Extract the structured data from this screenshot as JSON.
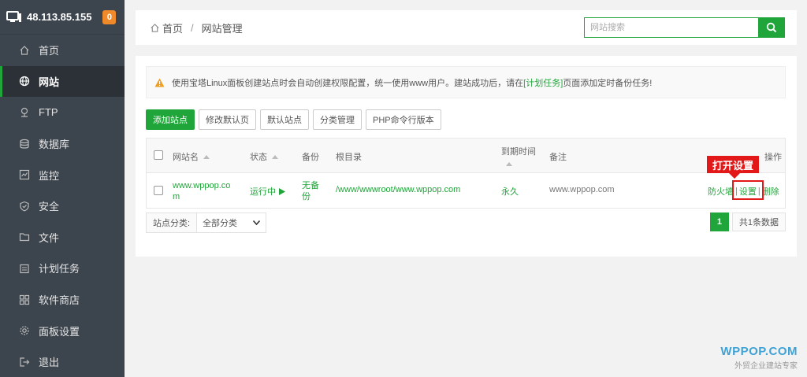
{
  "sidebar": {
    "ip": "48.113.85.155",
    "badge": "0",
    "items": [
      {
        "label": "首页",
        "icon": "home-icon"
      },
      {
        "label": "网站",
        "icon": "globe-icon",
        "active": true
      },
      {
        "label": "FTP",
        "icon": "ftp-icon"
      },
      {
        "label": "数据库",
        "icon": "database-icon"
      },
      {
        "label": "监控",
        "icon": "monitor-icon"
      },
      {
        "label": "安全",
        "icon": "shield-icon"
      },
      {
        "label": "文件",
        "icon": "folder-icon"
      },
      {
        "label": "计划任务",
        "icon": "calendar-icon"
      },
      {
        "label": "软件商店",
        "icon": "grid-icon"
      },
      {
        "label": "面板设置",
        "icon": "gear-icon"
      },
      {
        "label": "退出",
        "icon": "logout-icon"
      }
    ]
  },
  "header": {
    "breadcrumb_home": "首页",
    "breadcrumb_sep": "/",
    "breadcrumb_current": "网站管理",
    "search_placeholder": "网站搜索"
  },
  "alert": {
    "text_before": "使用宝塔Linux面板创建站点时会自动创建权限配置，统一使用www用户。建站成功后，请在",
    "link": "[计划任务]",
    "text_after": "页面添加定时备份任务!"
  },
  "toolbar": {
    "add_site": "添加站点",
    "edit_default_page": "修改默认页",
    "default_site": "默认站点",
    "category_manage": "分类管理",
    "php_cli_version": "PHP命令行版本"
  },
  "table": {
    "headers": {
      "site_name": "网站名",
      "status": "状态",
      "backup": "备份",
      "root_dir": "根目录",
      "expire_time": "到期时间",
      "note": "备注",
      "actions": "操作"
    },
    "rows": [
      {
        "site_name_line1": "www.wppop.co",
        "site_name_line2": "m",
        "status": "运行中",
        "backup_line1": "无备",
        "backup_line2": "份",
        "root_dir": "/www/wwwroot/www.wppop.com",
        "expire_time": "永久",
        "note": "www.wppop.com",
        "action_firewall": "防火墙",
        "action_settings": "设置",
        "action_delete": "删除",
        "action_sep": "|"
      }
    ]
  },
  "callout": "打开设置",
  "footer": {
    "category_label": "站点分类:",
    "category_value": "全部分类",
    "page_current": "1",
    "total_text": "共1条数据"
  },
  "watermark": {
    "brand": "WPPOP.COM",
    "tagline": "外贸企业建站专家"
  },
  "colors": {
    "accent": "#20a53a",
    "sidebar_bg": "#3c444d",
    "badge": "#f0892a",
    "callout": "#e31818",
    "watermark": "#3fa2d6"
  }
}
